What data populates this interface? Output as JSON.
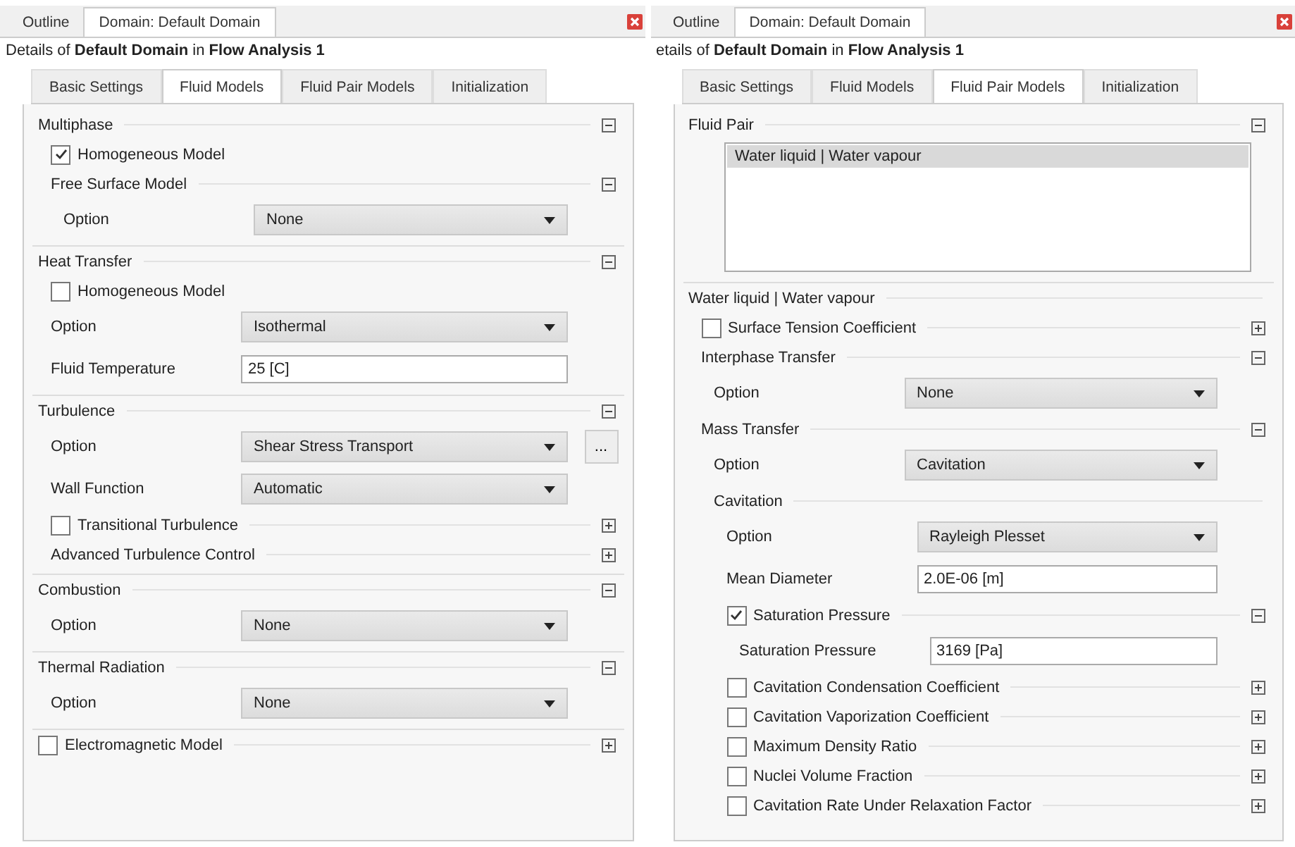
{
  "panels": [
    {
      "top_tabs": [
        {
          "label": "Outline",
          "selected": false
        },
        {
          "label": "Domain: Default Domain",
          "selected": true
        }
      ],
      "details": "Details of **Default Domain** in **Flow Analysis 1**",
      "tabs": [
        {
          "label": "Basic Settings",
          "selected": false
        },
        {
          "label": "Fluid Models",
          "selected": true
        },
        {
          "label": "Fluid Pair Models",
          "selected": false
        },
        {
          "label": "Initialization",
          "selected": false
        }
      ],
      "items": [
        {
          "kind": "section",
          "title": "Multiphase",
          "expanded": true,
          "children": [
            {
              "kind": "check",
              "label": "Homogeneous Model",
              "checked": true
            },
            {
              "kind": "section",
              "title": "Free Surface Model",
              "expanded": true,
              "children": [
                {
                  "kind": "dropdown",
                  "label": "Option",
                  "value": "None"
                }
              ]
            }
          ]
        },
        {
          "kind": "section",
          "title": "Heat Transfer",
          "expanded": true,
          "children": [
            {
              "kind": "check",
              "label": "Homogeneous Model",
              "checked": false
            },
            {
              "kind": "dropdown",
              "label": "Option",
              "value": "Isothermal"
            },
            {
              "kind": "field",
              "label": "Fluid Temperature",
              "value": "25 [C]"
            }
          ]
        },
        {
          "kind": "section",
          "title": "Turbulence",
          "expanded": true,
          "children": [
            {
              "kind": "dropdown",
              "label": "Option",
              "value": "Shear Stress Transport",
              "more_button": "..."
            },
            {
              "kind": "dropdown",
              "label": "Wall Function",
              "value": "Automatic"
            },
            {
              "kind": "section",
              "title": "Transitional Turbulence",
              "checked": false,
              "expanded": false
            },
            {
              "kind": "section",
              "title": "Advanced Turbulence Control",
              "expanded": false
            }
          ]
        },
        {
          "kind": "section",
          "title": "Combustion",
          "expanded": true,
          "children": [
            {
              "kind": "dropdown",
              "label": "Option",
              "value": "None"
            }
          ]
        },
        {
          "kind": "section",
          "title": "Thermal Radiation",
          "expanded": true,
          "children": [
            {
              "kind": "dropdown",
              "label": "Option",
              "value": "None"
            }
          ]
        },
        {
          "kind": "section",
          "title": "Electromagnetic Model",
          "checked": false,
          "expanded": false
        }
      ]
    },
    {
      "top_tabs": [
        {
          "label": "Outline",
          "selected": false
        },
        {
          "label": "Domain: Default Domain",
          "selected": true
        }
      ],
      "details": "etails of **Default Domain** in **Flow Analysis 1**",
      "tabs": [
        {
          "label": "Basic Settings",
          "selected": false
        },
        {
          "label": "Fluid Models",
          "selected": false
        },
        {
          "label": "Fluid Pair Models",
          "selected": true
        },
        {
          "label": "Initialization",
          "selected": false
        }
      ],
      "items": [
        {
          "kind": "section",
          "title": "Fluid Pair",
          "expanded": true,
          "children": [
            {
              "kind": "listbox",
              "items": [
                {
                  "text": "Water liquid | Water vapour",
                  "selected": true
                }
              ]
            }
          ]
        },
        {
          "kind": "section",
          "title": "Water liquid | Water vapour",
          "children": [
            {
              "kind": "section",
              "title": "Surface Tension Coefficient",
              "checked": false,
              "expanded": false
            },
            {
              "kind": "section",
              "title": "Interphase Transfer",
              "expanded": true,
              "children": [
                {
                  "kind": "dropdown",
                  "label": "Option",
                  "value": "None"
                }
              ]
            },
            {
              "kind": "section",
              "title": "Mass Transfer",
              "expanded": true,
              "children": [
                {
                  "kind": "dropdown",
                  "label": "Option",
                  "value": "Cavitation"
                },
                {
                  "kind": "section",
                  "title": "Cavitation",
                  "children": [
                    {
                      "kind": "dropdown",
                      "label": "Option",
                      "value": "Rayleigh Plesset"
                    },
                    {
                      "kind": "field",
                      "label": "Mean Diameter",
                      "value": "2.0E-06 [m]"
                    },
                    {
                      "kind": "section",
                      "title": "Saturation Pressure",
                      "checked": true,
                      "expanded": true,
                      "children": [
                        {
                          "kind": "field",
                          "label": "Saturation Pressure",
                          "value": "3169 [Pa]"
                        }
                      ]
                    },
                    {
                      "kind": "section",
                      "title": "Cavitation Condensation Coefficient",
                      "checked": false,
                      "expanded": false
                    },
                    {
                      "kind": "section",
                      "title": "Cavitation Vaporization Coefficient",
                      "checked": false,
                      "expanded": false
                    },
                    {
                      "kind": "section",
                      "title": "Maximum Density Ratio",
                      "checked": false,
                      "expanded": false
                    },
                    {
                      "kind": "section",
                      "title": "Nuclei Volume Fraction",
                      "checked": false,
                      "expanded": false
                    },
                    {
                      "kind": "section",
                      "title": "Cavitation Rate Under Relaxation Factor",
                      "checked": false,
                      "expanded": false
                    }
                  ]
                }
              ]
            }
          ]
        }
      ]
    }
  ]
}
